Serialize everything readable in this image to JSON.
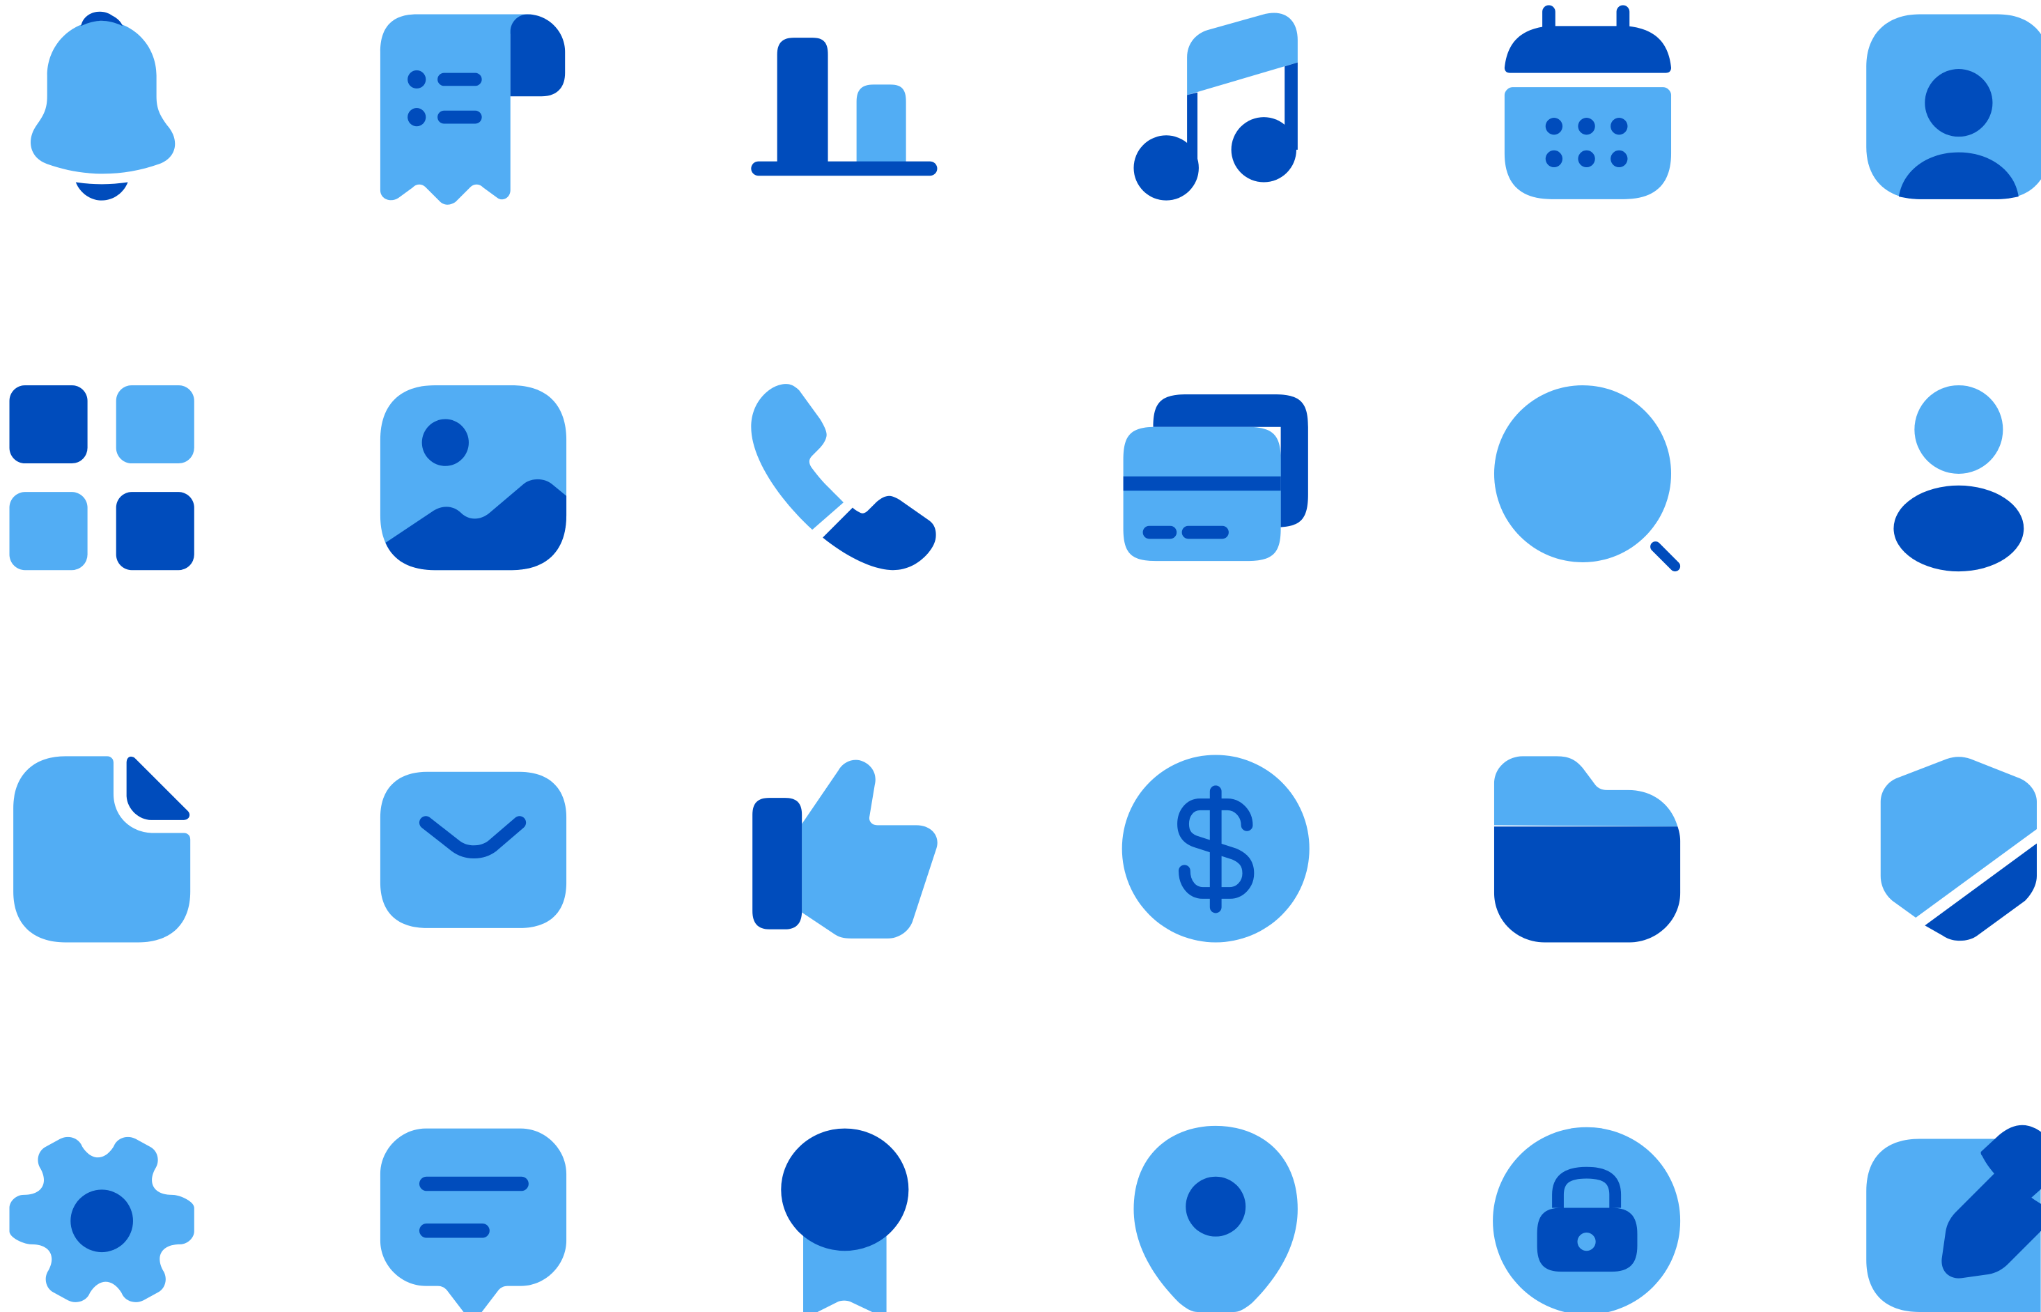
{
  "colors": {
    "background": "#ffffff",
    "light": "#52adf4",
    "dark": "#004cbc"
  },
  "icons": [
    [
      "bell-icon",
      "receipt-icon",
      "chart-icon",
      "music-note-icon",
      "calendar-icon",
      "profile-card-icon"
    ],
    [
      "grid-icon",
      "image-icon",
      "phone-icon",
      "cards-icon",
      "search-icon",
      "user-icon"
    ],
    [
      "document-icon",
      "mail-icon",
      "thumbs-up-icon",
      "dollar-circle-icon",
      "folder-icon",
      "shield-icon"
    ],
    [
      "gear-icon",
      "message-icon",
      "award-icon",
      "location-pin-icon",
      "lock-circle-icon",
      "edit-icon"
    ]
  ]
}
